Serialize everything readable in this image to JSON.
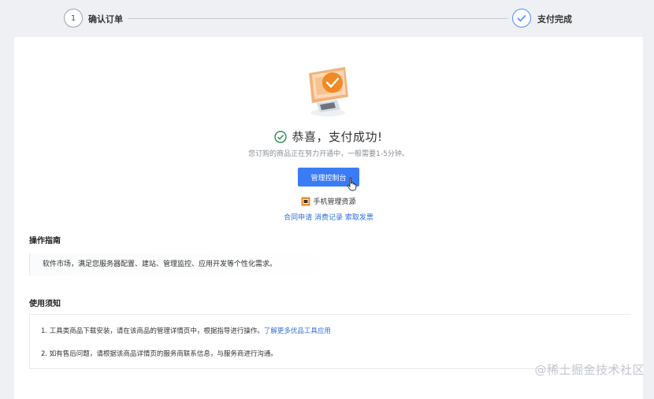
{
  "steps": {
    "step1_number": "1",
    "step1_label": "确认订单",
    "step2_label": "支付完成"
  },
  "result": {
    "title": "恭喜，支付成功!",
    "subtitle": "您订购的商品正在努力开通中，一般需要1-5分钟。",
    "console_button": "管理控制台",
    "mobile_label": "手机管理资源",
    "links": [
      "合同申请",
      "消费记录",
      "索取发票"
    ]
  },
  "guide": {
    "title": "操作指南",
    "text": "软件市场，满足您服务器配置、建站、管理监控、应用开发等个性化需求。"
  },
  "notice": {
    "title": "使用须知",
    "item1": "1. 工具类商品下载安装，请在该商品的管理详情页中，根据指导进行操作。",
    "item1_link": "了解更多优品工具应用",
    "item2": "2. 如有售后问题，请根据该商品详情页的服务商联系信息，与服务商进行沟通。"
  },
  "watermark": "@稀土掘金技术社区",
  "colors": {
    "primary": "#3a7cf6",
    "link": "#2f6fd6",
    "success": "#2e8b57",
    "accent_orange": "#f08a24"
  },
  "icons": [
    "check-icon",
    "success-check-icon",
    "payment-illustration",
    "mobile-icon",
    "hand-cursor-icon"
  ]
}
